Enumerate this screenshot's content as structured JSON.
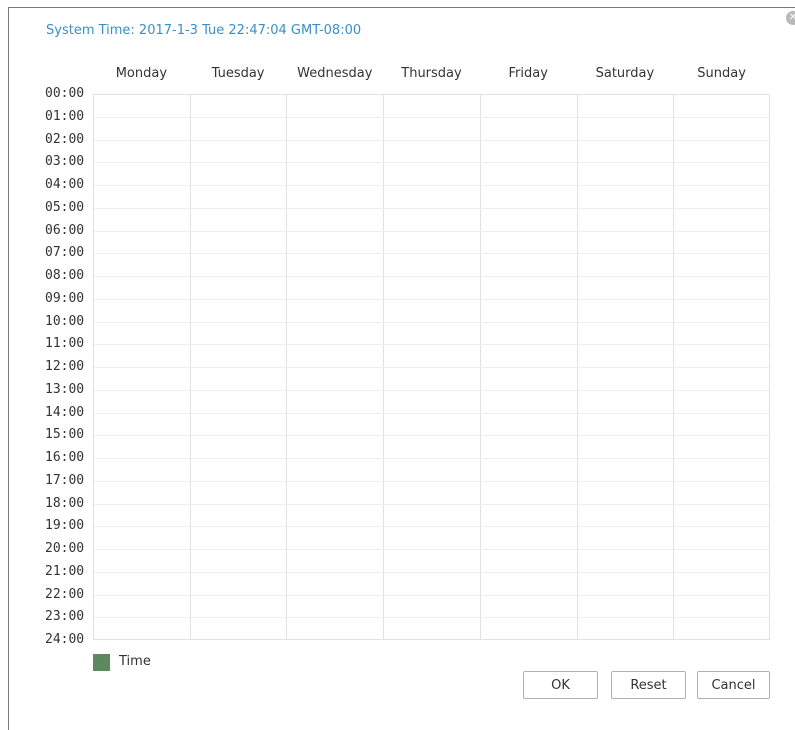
{
  "system_time": "System Time: 2017-1-3 Tue 22:47:04 GMT-08:00",
  "days": [
    "Monday",
    "Tuesday",
    "Wednesday",
    "Thursday",
    "Friday",
    "Saturday",
    "Sunday"
  ],
  "hours": [
    "00:00",
    "01:00",
    "02:00",
    "03:00",
    "04:00",
    "05:00",
    "06:00",
    "07:00",
    "08:00",
    "09:00",
    "10:00",
    "11:00",
    "12:00",
    "13:00",
    "14:00",
    "15:00",
    "16:00",
    "17:00",
    "18:00",
    "19:00",
    "20:00",
    "21:00",
    "22:00",
    "23:00",
    "24:00"
  ],
  "legend": {
    "label": "Time",
    "color": "#5b8a5e"
  },
  "buttons": {
    "ok": "OK",
    "reset": "Reset",
    "cancel": "Cancel"
  },
  "close_icon": "close-icon"
}
